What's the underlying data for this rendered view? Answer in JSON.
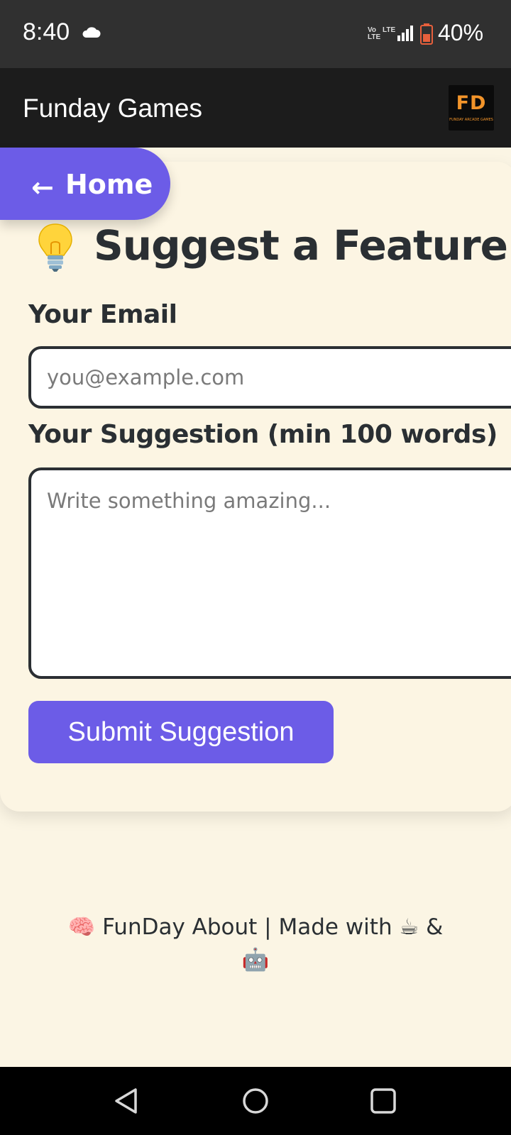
{
  "status_bar": {
    "time": "8:40",
    "net_top": "Vo",
    "net_bottom": "LTE",
    "net_top2": "LTE",
    "battery": "40%"
  },
  "app_bar": {
    "title": "Funday Games",
    "logo_text": "FD",
    "logo_sub": "FUNDAY ARCADE GAMES"
  },
  "nav": {
    "home_arrow": "←",
    "home_label": "Home"
  },
  "form": {
    "title": "Suggest a Feature",
    "email_label": "Your Email",
    "email_placeholder": "you@example.com",
    "email_value": "",
    "suggestion_label": "Your Suggestion (min 100 words)",
    "suggestion_placeholder": "Write something amazing...",
    "suggestion_value": "",
    "submit_label": "Submit Suggestion"
  },
  "footer": {
    "line1": "🧠 FunDay About | Made with ☕ &",
    "line2": "🤖"
  },
  "colors": {
    "accent": "#6c5ce7",
    "background": "#fbf5e4",
    "app_bar": "#1c1c1c",
    "status_bar": "#303030",
    "text": "#2a2f33"
  }
}
